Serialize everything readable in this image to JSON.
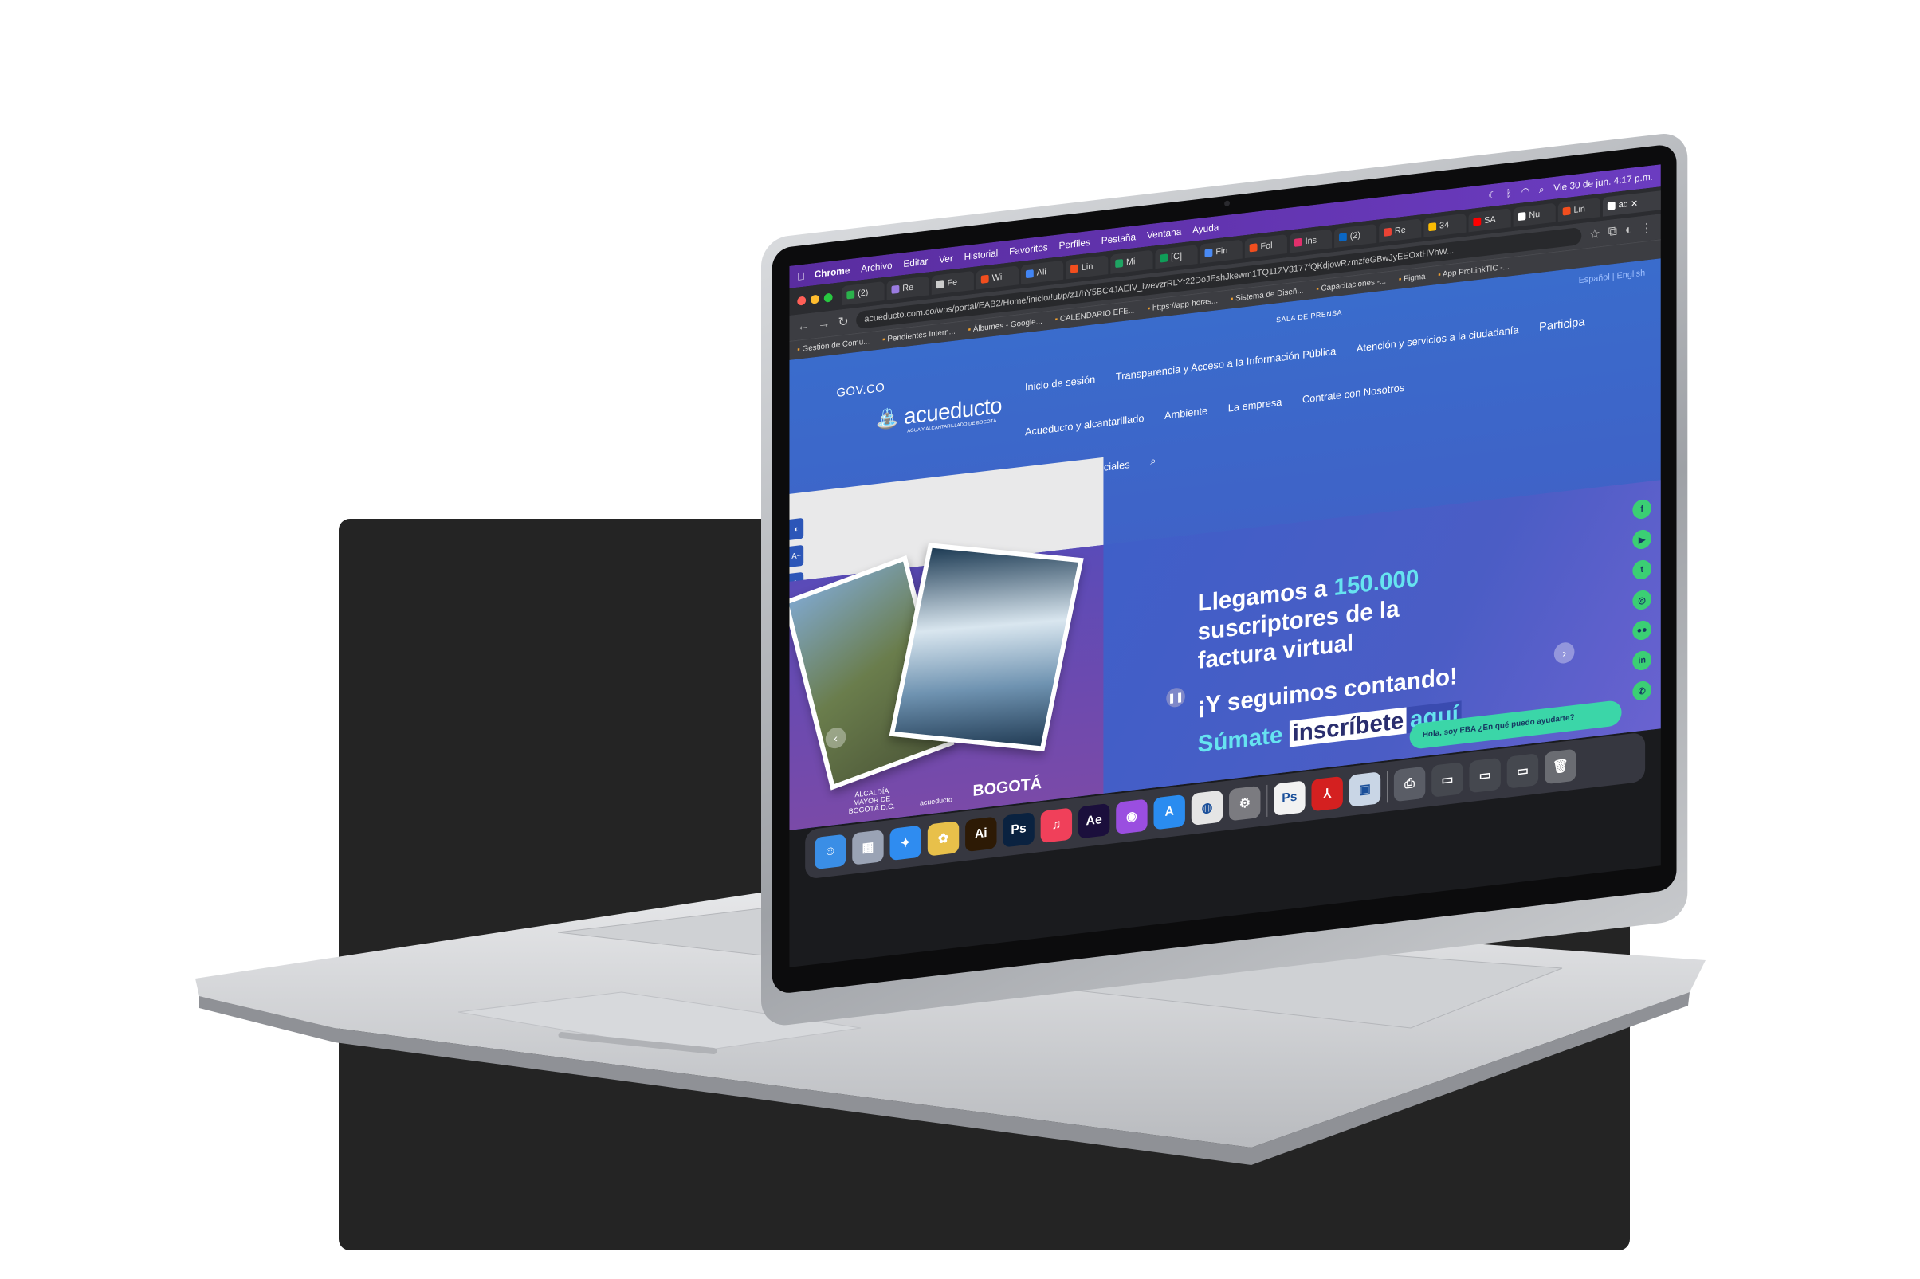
{
  "menubar": {
    "items": [
      "Chrome",
      "Archivo",
      "Editar",
      "Ver",
      "Historial",
      "Favoritos",
      "Perfiles",
      "Pestaña",
      "Ventana",
      "Ayuda"
    ],
    "clock": "Vie 30 de jun. 4:17 p.m."
  },
  "tabs": [
    "(2)",
    "Re",
    "Fe",
    "Wi",
    "Ali",
    "Lin",
    "Mi",
    "[C]",
    "Fin",
    "Fol",
    "Ins",
    "(2)",
    "Re",
    "34",
    "SA",
    "Nu",
    "Lin",
    "ac"
  ],
  "active_tab": "ac",
  "url": "acueducto.com.co/wps/portal/EAB2/Home/inicio/!ut/p/z1/hY5BC4JAEIV_iwevzrRLYt22DoJEshJkewm1TQ11ZV3177fQKdjowRzmzfeGBwJyEEOxtHVhW...",
  "bookmarks": [
    "Gestión de Comu...",
    "Pendientes Intern...",
    "Álbumes - Google...",
    "CALENDARIO EFE...",
    "https://app-horas...",
    "Sistema de Diseñ...",
    "Capacitaciones -...",
    "Figma",
    "App ProLinkTIC -..."
  ],
  "site": {
    "gov": "GOV.CO",
    "sala": "SALA DE PRENSA",
    "langs": "Español | English",
    "logo_word": "acueducto",
    "logo_tag": "AGUA Y ALCANTARILLADO DE BOGOTÁ",
    "nav_row1": [
      "Inicio de sesión",
      "Transparencia y Acceso a la Información Pública",
      "Atención y servicios a la ciudadanía",
      "Participa"
    ],
    "nav_row2": [
      "Acueducto y alcantarillado",
      "Ambiente",
      "La empresa",
      "Contrate con Nosotros"
    ],
    "nav_row3": [
      "Clientes Preferenciales"
    ],
    "hero_line1": "Llegamos a ",
    "hero_highlight": "150.000",
    "hero_line2": "suscriptores de la factura virtual",
    "hero_sub": "¡Y seguimos contando!",
    "cta_prefix": "Súmate",
    "cta_box": "inscríbete",
    "cta_aqui": "aquí",
    "chatbot": "Hola, soy EBA ¿En qué puedo ayudarte?",
    "art_bogota": "BOGOTÁ",
    "art_alcaldia": "ALCALDÍA MAYOR DE BOGOTÁ D.C.",
    "art_acueducto": "acueducto"
  },
  "social": [
    "f",
    "▶",
    "t",
    "◎",
    "●●",
    "in",
    "✆"
  ],
  "dock": [
    {
      "name": "finder",
      "label": "☺",
      "color": "#3a8ee6"
    },
    {
      "name": "launchpad",
      "label": "▦",
      "color": "#9aa3b5"
    },
    {
      "name": "safari",
      "label": "✦",
      "color": "#2f8cf0"
    },
    {
      "name": "photos",
      "label": "✿",
      "color": "#e8c04a"
    },
    {
      "name": "illustrator",
      "label": "Ai",
      "color": "#2d1a05"
    },
    {
      "name": "photoshop",
      "label": "Ps",
      "color": "#0a2240"
    },
    {
      "name": "music",
      "label": "♫",
      "color": "#f0405a"
    },
    {
      "name": "after-effects",
      "label": "Ae",
      "color": "#1b0f3c"
    },
    {
      "name": "podcasts",
      "label": "◉",
      "color": "#9a4ee0"
    },
    {
      "name": "app-store",
      "label": "A",
      "color": "#2a8cf0"
    },
    {
      "name": "chrome",
      "label": "◍",
      "color": "#e5e5e5"
    },
    {
      "name": "system-settings",
      "label": "⚙",
      "color": "#7b7b80"
    },
    {
      "name": "photoshop-2",
      "label": "Ps",
      "color": "#f2f2f2"
    },
    {
      "name": "acrobat",
      "label": "⅄",
      "color": "#d42020"
    },
    {
      "name": "preview",
      "label": "▣",
      "color": "#c9d6e6"
    },
    {
      "name": "printer",
      "label": "⎙",
      "color": "#5a5d66"
    },
    {
      "name": "window-1",
      "label": "▭",
      "color": "#45484f"
    },
    {
      "name": "window-2",
      "label": "▭",
      "color": "#45484f"
    },
    {
      "name": "window-3",
      "label": "▭",
      "color": "#45484f"
    },
    {
      "name": "trash",
      "label": "🗑",
      "color": "#6a6c72"
    }
  ]
}
